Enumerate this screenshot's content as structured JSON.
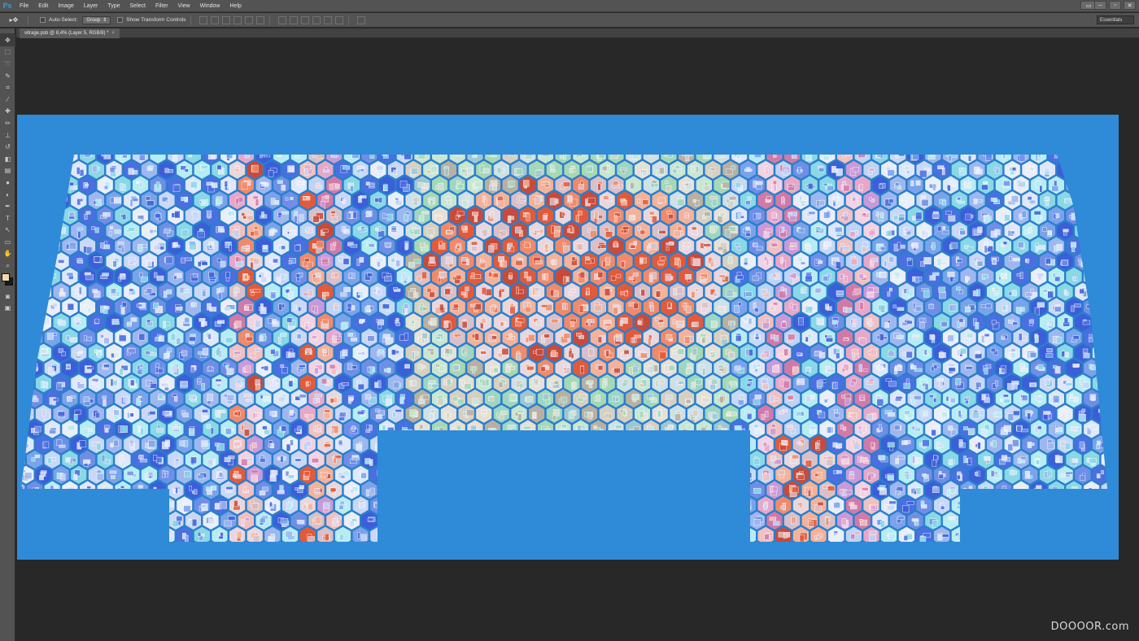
{
  "app": {
    "logo": "Ps"
  },
  "menu": [
    "File",
    "Edit",
    "Image",
    "Layer",
    "Type",
    "Select",
    "Filter",
    "View",
    "Window",
    "Help"
  ],
  "window_controls": {
    "minimize": "–",
    "restore": "▫",
    "close": "✕",
    "arrange": "▭"
  },
  "options_bar": {
    "tool_glyph": "▸✥",
    "auto_select_label": "Auto-Select:",
    "auto_select_value": "Group",
    "transform_label": "Show Transform Controls",
    "workspace": "Essentials"
  },
  "document_tab": {
    "title": "vitrage.psb @ 8,4% (Layer 5, RGB/8) *",
    "close": "×"
  },
  "tools": [
    {
      "name": "move-tool",
      "glyph": "✥"
    },
    {
      "name": "marquee-tool",
      "glyph": "⬚"
    },
    {
      "name": "lasso-tool",
      "glyph": "➰"
    },
    {
      "name": "quick-select-tool",
      "glyph": "✎"
    },
    {
      "name": "crop-tool",
      "glyph": "⌗"
    },
    {
      "name": "eyedropper-tool",
      "glyph": "⁄"
    },
    {
      "name": "healing-tool",
      "glyph": "✚"
    },
    {
      "name": "brush-tool",
      "glyph": "✏"
    },
    {
      "name": "stamp-tool",
      "glyph": "⊥"
    },
    {
      "name": "history-brush-tool",
      "glyph": "↺"
    },
    {
      "name": "eraser-tool",
      "glyph": "◧"
    },
    {
      "name": "gradient-tool",
      "glyph": "▤"
    },
    {
      "name": "blur-tool",
      "glyph": "●"
    },
    {
      "name": "dodge-tool",
      "glyph": "◐"
    },
    {
      "name": "pen-tool",
      "glyph": "✒"
    },
    {
      "name": "type-tool",
      "glyph": "T"
    },
    {
      "name": "path-select-tool",
      "glyph": "↖"
    },
    {
      "name": "shape-tool",
      "glyph": "▭"
    },
    {
      "name": "hand-tool",
      "glyph": "✋"
    },
    {
      "name": "zoom-tool",
      "glyph": "⌕"
    }
  ],
  "colors": {
    "foreground": "#f2d9a6",
    "background": "#1a1a1a",
    "canvas": "#2f8ad8",
    "frame": "#2a7fcc"
  },
  "bottom_tools": [
    {
      "name": "quick-mask-button",
      "glyph": "◙"
    },
    {
      "name": "screen-mode-button",
      "glyph": "▣"
    }
  ],
  "watermark": "DOOOOR.com"
}
